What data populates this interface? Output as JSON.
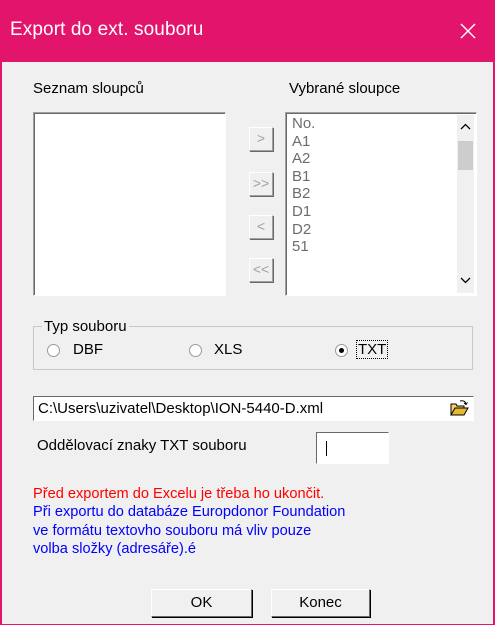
{
  "window": {
    "title": "Export do ext. souboru",
    "close_glyph": "✕",
    "titlebar_color": "#e3146c"
  },
  "lists": {
    "available_label": "Seznam sloupců",
    "selected_label": "Vybrané sloupce",
    "selected_items": [
      "No.",
      "A1",
      "A2",
      "B1",
      "B2",
      "D1",
      "D2",
      "51"
    ]
  },
  "transfer_buttons": {
    "add_one": ">",
    "add_all": ">>",
    "remove_one": "<",
    "remove_all": "<<"
  },
  "file_type": {
    "group_label": "Typ souboru",
    "options": [
      {
        "label": "DBF",
        "selected": false
      },
      {
        "label": "XLS",
        "selected": false
      },
      {
        "label": "TXT",
        "selected": true
      }
    ]
  },
  "path": {
    "value": "C:\\Users\\uzivatel\\Desktop\\ION-5440-D.xml",
    "browse_icon": "folder-open-icon"
  },
  "separator": {
    "label": "Oddělovací znaky TXT souboru",
    "value": ""
  },
  "messages": {
    "red_line": "Před exportem do Excelu je třeba ho ukončit.",
    "blue_lines": [
      "Při exportu do databáze Europdonor Foundation",
      "ve formátu textovho souboru má vliv pouze",
      "volba složky (adresáře).é"
    ],
    "red_color": "#ff0000",
    "blue_color": "#0000ff"
  },
  "buttons": {
    "ok": "OK",
    "close": "Konec"
  }
}
